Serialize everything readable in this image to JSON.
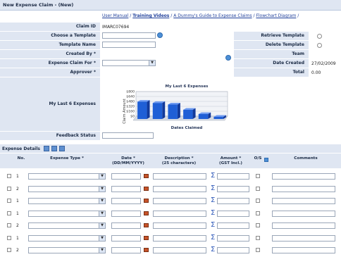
{
  "window": {
    "title": "New Expense Claim - (New)"
  },
  "links": {
    "user_manual": "User Manual",
    "training_videos": "Training Videos",
    "dummys_guide": "A Dummy's Guide to Expense Claims",
    "flowchart": "Flowchart Diagram",
    "sep": " / "
  },
  "form": {
    "claim_id_label": "Claim ID",
    "claim_id_value": "IMARC07694",
    "template_label": "Choose a Template",
    "template_name_label": "Template Name",
    "created_by_label": "Created By *",
    "expense_for_label": "Expense Claim For *",
    "approver_label": "Approver *",
    "last6_label": "My Last 6 Expenses",
    "feedback_label": "Feedback Status",
    "retrieve_label": "Retrieve Template",
    "delete_label": "Delete Template",
    "team_label": "Team",
    "date_created_label": "Date Created",
    "date_created_value": "27/02/2009",
    "total_label": "Total",
    "total_value": "0.00"
  },
  "chart_data": {
    "type": "bar",
    "title": "My Last 6 Expenses",
    "xlabel": "Dates Claimed",
    "ylabel": "Claim Amount",
    "yticks": [
      "$800",
      "$640",
      "$480",
      "$320",
      "$160",
      "$0"
    ],
    "ylim": [
      0,
      800
    ],
    "values": [
      560,
      520,
      470,
      300,
      160,
      70
    ],
    "color": "#1f5fd6"
  },
  "details": {
    "title": "Expense Details",
    "headers": {
      "no": "No.",
      "type": "Expense Type *",
      "date1": "Date *",
      "date2": "(DD/MM/YYYY)",
      "desc1": "Description *",
      "desc2": "(25 characters)",
      "amount1": "Amount *",
      "amount2": "(GST Incl.)",
      "os": "O/S",
      "comments": "Comments"
    },
    "rows": [
      {
        "no": "1"
      },
      {
        "no": "2"
      },
      {
        "no": "1"
      },
      {
        "no": "1"
      },
      {
        "no": "2"
      },
      {
        "no": "1"
      },
      {
        "no": "2"
      }
    ]
  }
}
